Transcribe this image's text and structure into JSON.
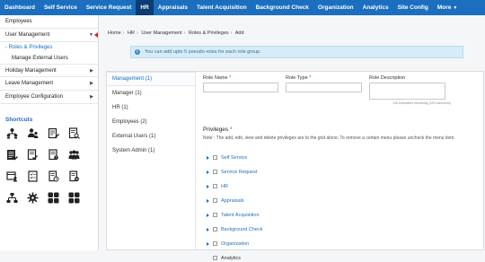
{
  "topnav": {
    "items": [
      {
        "label": "Dashboard"
      },
      {
        "label": "Self Service"
      },
      {
        "label": "Service Request"
      },
      {
        "label": "HR"
      },
      {
        "label": "Appraisals"
      },
      {
        "label": "Talent Acquisition"
      },
      {
        "label": "Background Check"
      },
      {
        "label": "Organization"
      },
      {
        "label": "Analytics"
      },
      {
        "label": "Site Config"
      },
      {
        "label": "More"
      }
    ],
    "active": "HR",
    "accent": "#1c6fbe",
    "active_color": "#0d3c74"
  },
  "sidebar": {
    "employees": "Employees",
    "user_management": "User Management",
    "roles_privileges": "Roles & Privileges",
    "manage_external_users": "Manage External Users",
    "holiday_management": "Holiday Management",
    "leave_management": "Leave Management",
    "employee_configuration": "Employee Configuration",
    "shortcuts_title": "Shortcuts",
    "shortcut_icons": [
      "people-tree-icon",
      "people-group-icon",
      "document-edit-icon",
      "document-search-icon",
      "list-edit-icon",
      "document-check-icon",
      "document-alert-icon",
      "users-icon",
      "calendar-person-icon",
      "document-list-icon",
      "document-clock-icon",
      "document-gear-icon",
      "org-chart-icon",
      "settings-icon",
      "apps-grid-icon",
      "apps-grid-alt-icon"
    ]
  },
  "breadcrumb": [
    "Home",
    "HR",
    "User Management",
    "Roles & Privileges",
    "Add"
  ],
  "alert": {
    "text": "You can add upto 5 pseudo-roles for each role group."
  },
  "roles": [
    {
      "label": "Management (1)"
    },
    {
      "label": "Manager (1)"
    },
    {
      "label": "HR (1)"
    },
    {
      "label": "Employees (2)"
    },
    {
      "label": "External Users (1)"
    },
    {
      "label": "System Admin (1)"
    }
  ],
  "form": {
    "role_name_label": "Role Name",
    "role_type_label": "Role Type",
    "role_description_label": "Role Description",
    "required_mark": "*",
    "char_hint": "100 characters remaining (100 maximum)",
    "role_name_value": "",
    "role_type_value": "",
    "role_description_value": ""
  },
  "privileges": {
    "title": "Privileges",
    "required_mark": "*",
    "note": "Note : The add, edit, view and delete privileges are to the grid alone. To remove a certain menu please uncheck the menu item.",
    "items": [
      {
        "label": "Self Service",
        "expandable": true
      },
      {
        "label": "Service Request",
        "expandable": true
      },
      {
        "label": "HR",
        "expandable": true
      },
      {
        "label": "Appraisals",
        "expandable": true
      },
      {
        "label": "Talent Acquisition",
        "expandable": true
      },
      {
        "label": "Background Check",
        "expandable": true
      },
      {
        "label": "Organization",
        "expandable": true
      },
      {
        "label": "Analytics",
        "expandable": false
      }
    ]
  }
}
